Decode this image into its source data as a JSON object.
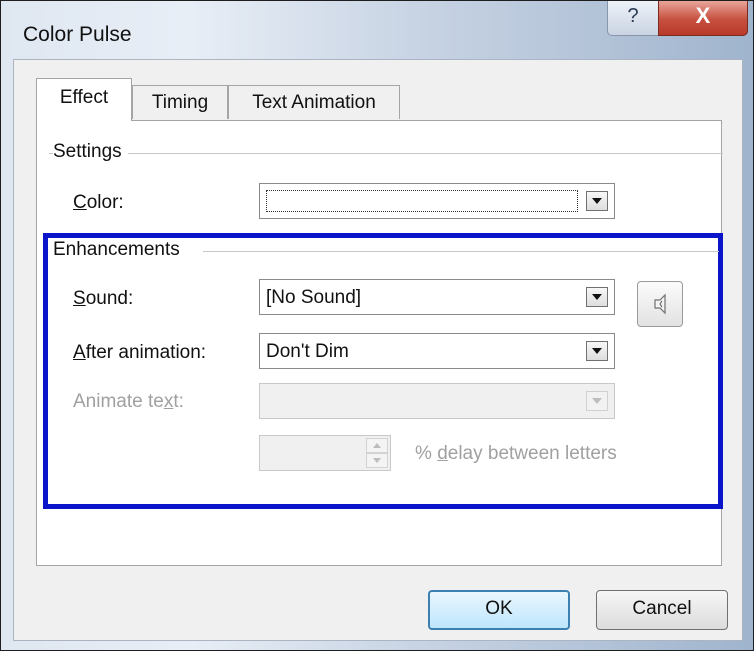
{
  "window": {
    "title": "Color Pulse",
    "help_glyph": "?",
    "close_glyph": "X"
  },
  "tabs": [
    {
      "label": "Effect",
      "active": true
    },
    {
      "label": "Timing",
      "active": false
    },
    {
      "label": "Text Animation",
      "active": false
    }
  ],
  "settings": {
    "group_title": "Settings",
    "color_label_accel": "C",
    "color_label_rest": "olor:",
    "color_value": ""
  },
  "enhancements": {
    "group_title": "Enhancements",
    "sound_label_accel": "S",
    "sound_label_rest": "ound:",
    "sound_value": "[No Sound]",
    "after_label_accel": "A",
    "after_label_rest": "fter animation:",
    "after_value": "Don't Dim",
    "animate_label_pre": "Animate te",
    "animate_label_accel": "x",
    "animate_label_post": "t:",
    "animate_value": "",
    "delay_value": "",
    "delay_label_pre": "% ",
    "delay_label_accel": "d",
    "delay_label_post": "elay between letters"
  },
  "buttons": {
    "ok": "OK",
    "cancel": "Cancel"
  },
  "colors": {
    "highlight_border": "#0a14c8",
    "disabled_text": "#a0a0a0"
  }
}
